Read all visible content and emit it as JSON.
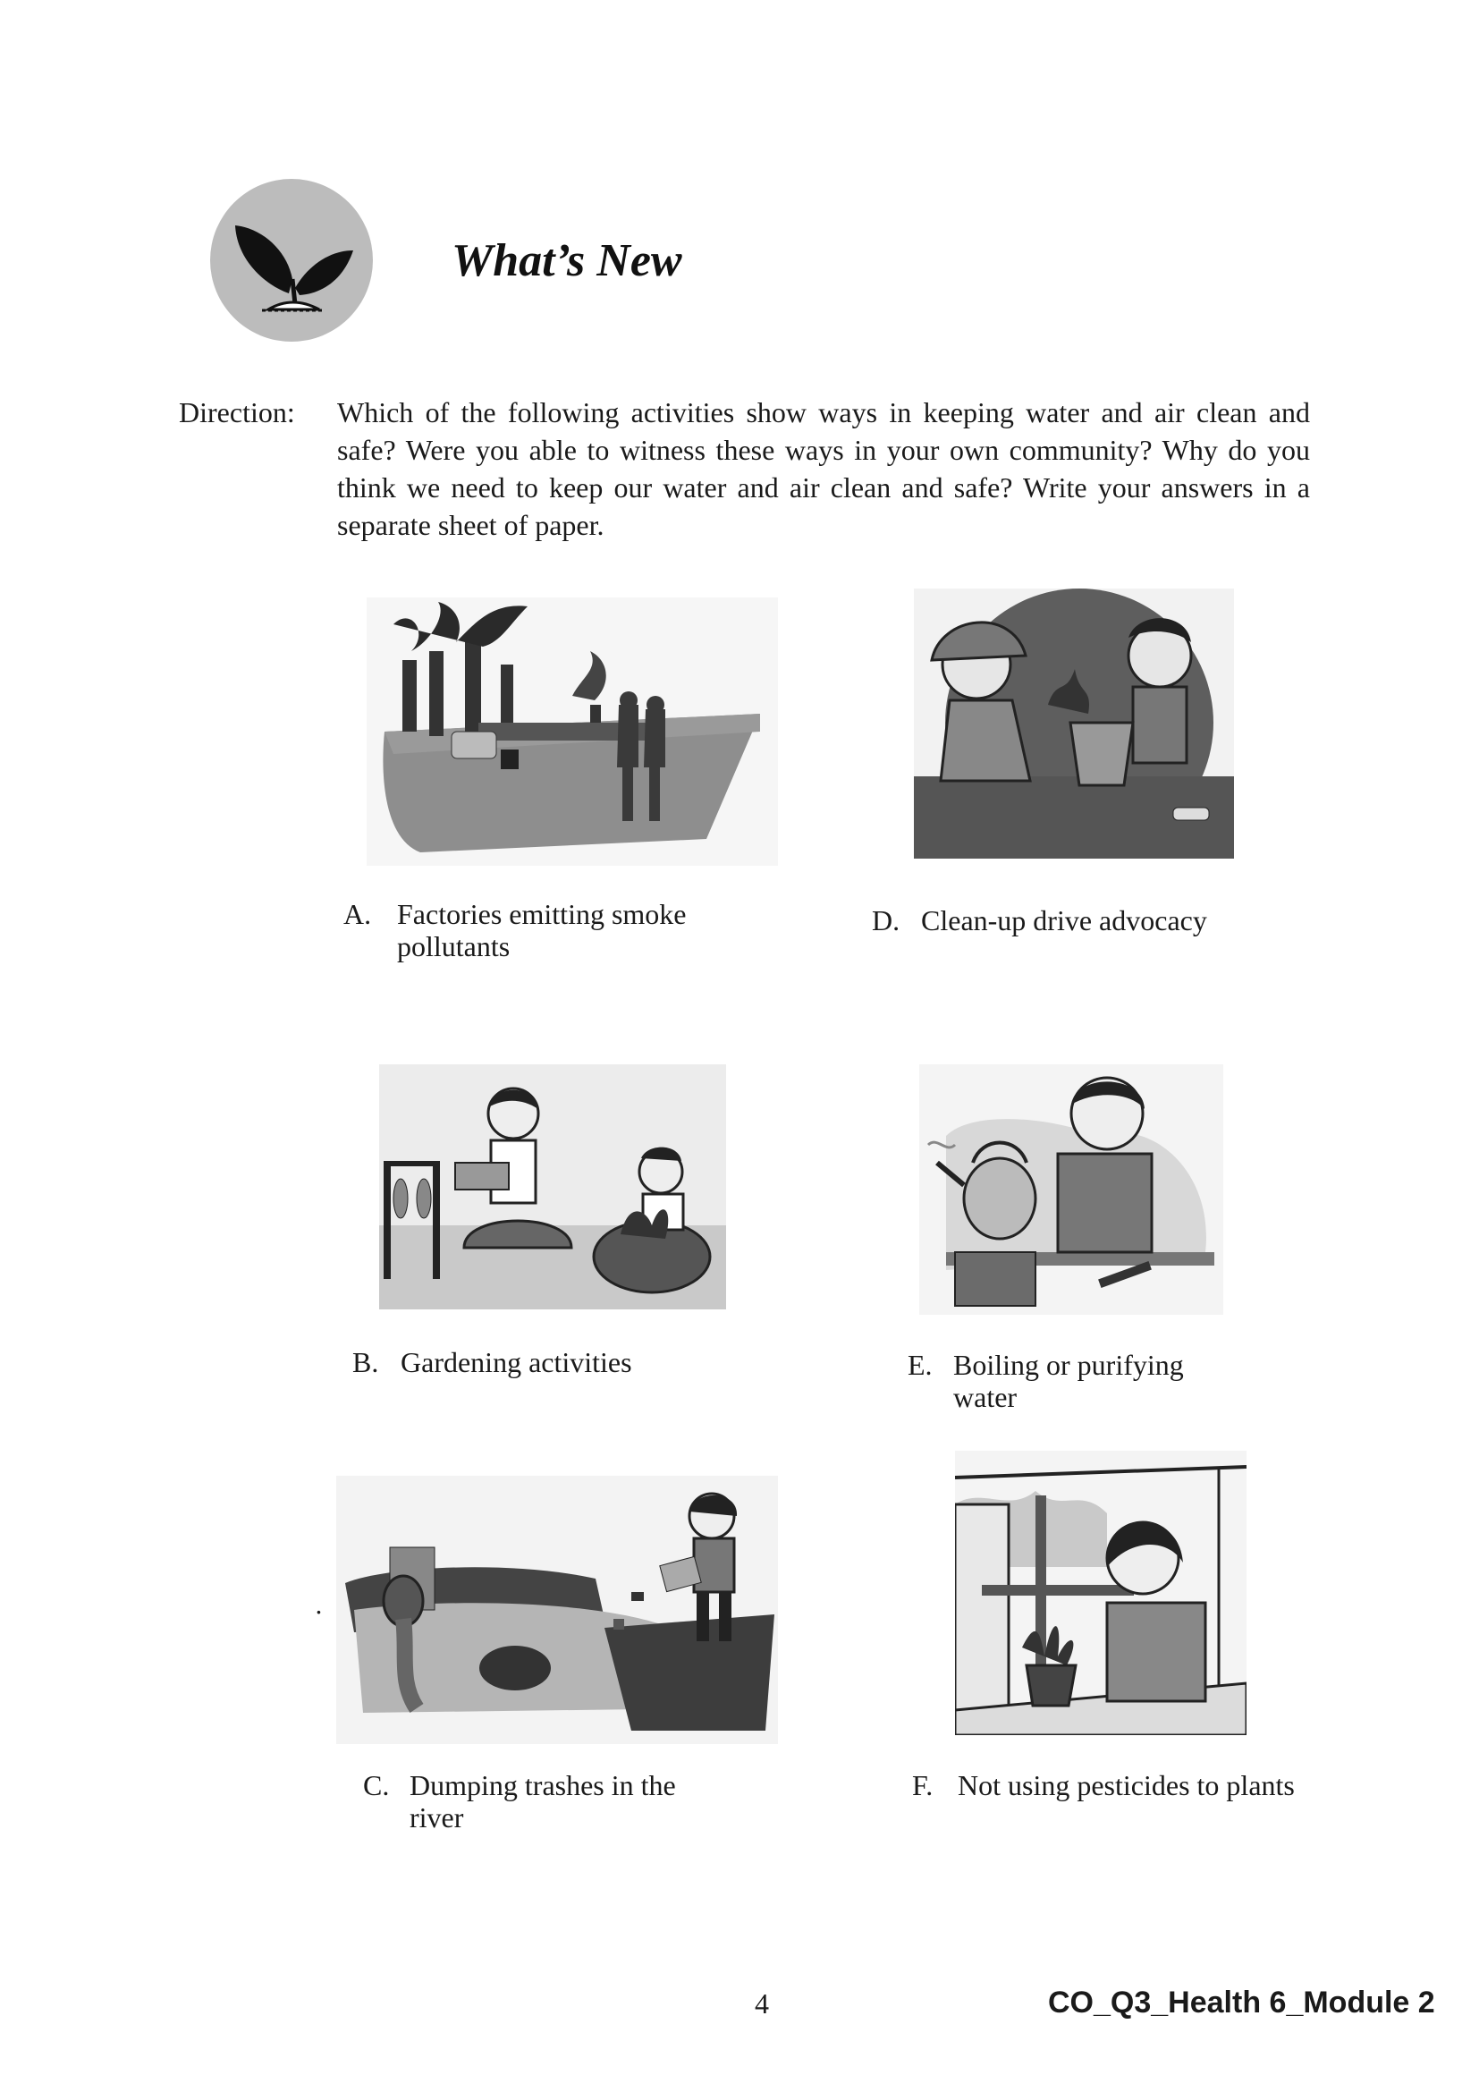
{
  "header": {
    "title": "What’s New",
    "icon": "plant-sprout-icon"
  },
  "direction": {
    "label": "Direction:",
    "text": "Which of the following activities show ways in keeping water and air clean and safe?  Were you able to witness these ways in your own community? Why do you think we need to keep our water and air clean and safe? Write your answers in a separate sheet of paper."
  },
  "items": [
    {
      "letter": "A.",
      "line1": "Factories emitting smoke",
      "line2": "pollutants",
      "image": "factory-smoke-illustration"
    },
    {
      "letter": "B.",
      "line1": "Gardening activities",
      "line2": "",
      "image": "children-gardening-illustration"
    },
    {
      "letter": "C.",
      "line1": "Dumping trashes in the",
      "line2": "river",
      "image": "boy-dumping-trash-illustration"
    },
    {
      "letter": "D.",
      "line1": "Clean-up drive advocacy",
      "line2": "",
      "image": "children-cleaning-illustration"
    },
    {
      "letter": "E.",
      "line1": "Boiling or purifying",
      "line2": "water",
      "image": "boy-boiling-water-illustration"
    },
    {
      "letter": "F.",
      "line1": "Not using pesticides to plants",
      "line2": "",
      "image": "girl-potted-plant-illustration"
    }
  ],
  "footer": {
    "page_number": "4",
    "module_code": "CO_Q3_Health 6_Module 2"
  },
  "colors": {
    "icon_circle": "#bcbcbc",
    "text": "#1a1a1a"
  }
}
